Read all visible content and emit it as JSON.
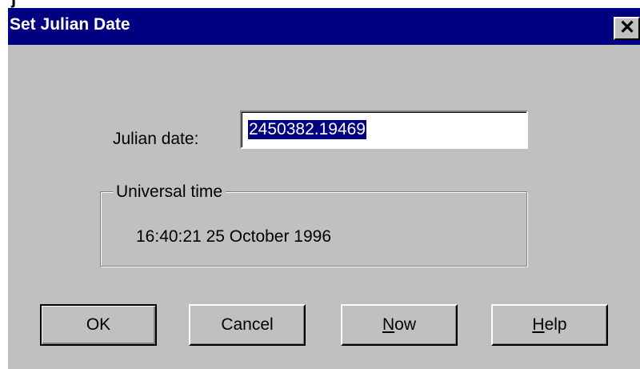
{
  "window": {
    "title": "Set Julian Date",
    "close_label": "✕"
  },
  "form": {
    "julian_label": "Julian date:",
    "julian_value": "2450382.19469"
  },
  "universal_time": {
    "legend": "Universal time",
    "value": "16:40:21 25 October 1996"
  },
  "buttons": {
    "ok": "OK",
    "cancel": "Cancel",
    "now_mnemonic": "N",
    "now_rest": "ow",
    "help_mnemonic": "H",
    "help_rest": "elp"
  },
  "colors": {
    "titlebar": "#000080",
    "dialog_face": "#c0c0c0",
    "selection": "#000080"
  }
}
